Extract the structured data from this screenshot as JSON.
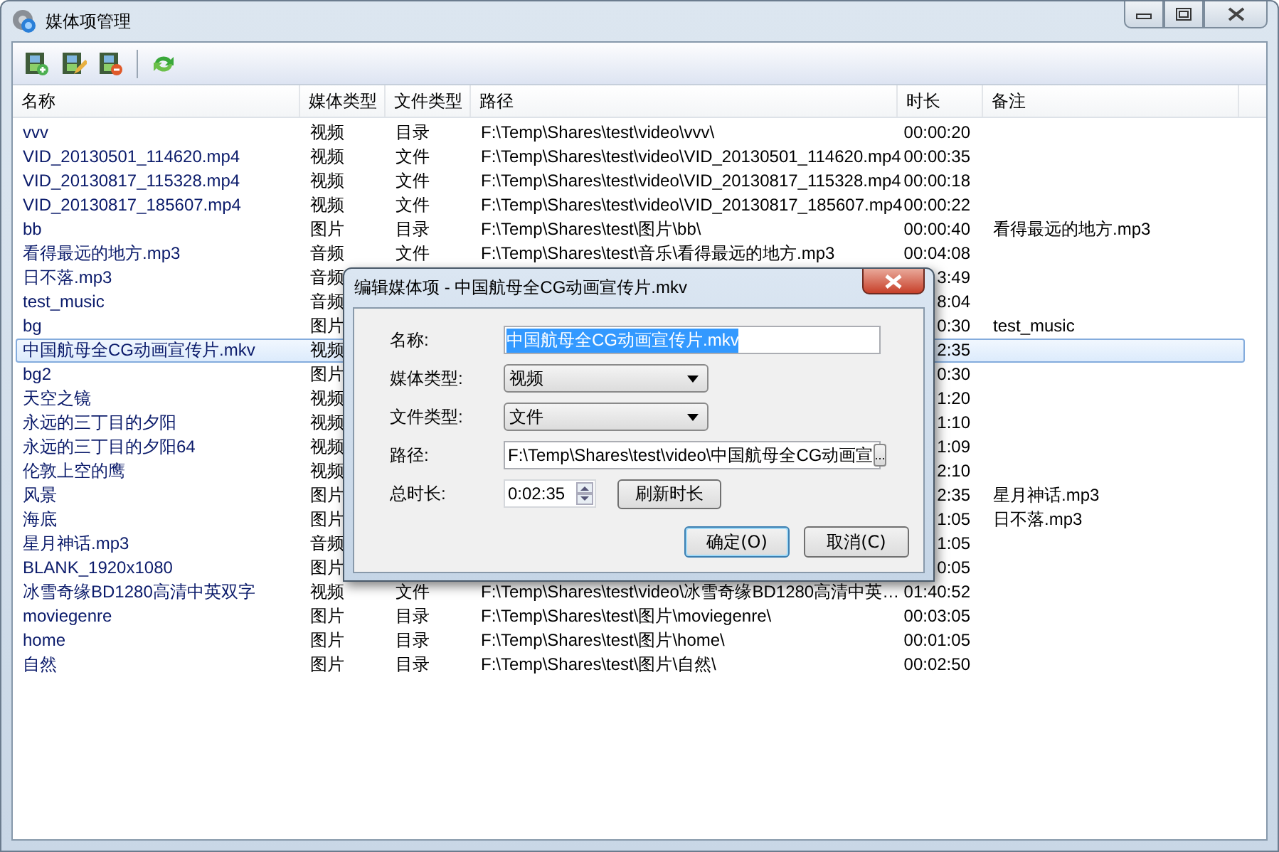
{
  "window": {
    "title": "媒体项管理"
  },
  "toolbar": [
    {
      "kind": "add"
    },
    {
      "kind": "edit"
    },
    {
      "kind": "delete"
    },
    {
      "kind": "refresh"
    }
  ],
  "table": {
    "columns": [
      "名称",
      "媒体类型",
      "文件类型",
      "路径",
      "时长",
      "备注"
    ],
    "rows": [
      {
        "selected": false,
        "name": "vvv",
        "media_type": "视频",
        "file_type": "目录",
        "path": "F:\\Temp\\Shares\\test\\video\\vvv\\",
        "duration": "00:00:20"
      },
      {
        "selected": false,
        "name": "VID_20130501_114620.mp4",
        "media_type": "视频",
        "file_type": "文件",
        "path": "F:\\Temp\\Shares\\test\\video\\VID_20130501_114620.mp4",
        "duration": "00:00:35"
      },
      {
        "selected": false,
        "name": "VID_20130817_115328.mp4",
        "media_type": "视频",
        "file_type": "文件",
        "path": "F:\\Temp\\Shares\\test\\video\\VID_20130817_115328.mp4",
        "duration": "00:00:18"
      },
      {
        "selected": false,
        "name": "VID_20130817_185607.mp4",
        "media_type": "视频",
        "file_type": "文件",
        "path": "F:\\Temp\\Shares\\test\\video\\VID_20130817_185607.mp4",
        "duration": "00:00:22"
      },
      {
        "selected": false,
        "name": "bb",
        "media_type": "图片",
        "file_type": "目录",
        "path": "F:\\Temp\\Shares\\test\\图片\\bb\\",
        "duration": "00:00:40",
        "note": "看得最远的地方.mp3"
      },
      {
        "selected": false,
        "name": "看得最远的地方.mp3",
        "media_type": "音频",
        "file_type": "文件",
        "path": "F:\\Temp\\Shares\\test\\音乐\\看得最远的地方.mp3",
        "duration": "00:04:08"
      },
      {
        "selected": false,
        "name": "日不落.mp3",
        "media_type": "音频",
        "duration": "3:49"
      },
      {
        "selected": false,
        "name": "test_music",
        "media_type": "音频",
        "duration": "8:04"
      },
      {
        "selected": false,
        "name": "bg",
        "media_type": "图片",
        "duration": "0:30",
        "note": "test_music"
      },
      {
        "selected": true,
        "name": "中国航母全CG动画宣传片.mkv",
        "media_type": "视频",
        "duration": "2:35"
      },
      {
        "selected": false,
        "name": "bg2",
        "media_type": "图片",
        "duration": "0:30"
      },
      {
        "selected": false,
        "name": "天空之镜",
        "media_type": "视频",
        "duration": "1:20"
      },
      {
        "selected": false,
        "name": "永远的三丁目的夕阳",
        "media_type": "视频",
        "duration": "1:10"
      },
      {
        "selected": false,
        "name": "永远的三丁目的夕阳64",
        "media_type": "视频",
        "duration": "1:09"
      },
      {
        "selected": false,
        "name": "伦敦上空的鹰",
        "media_type": "视频",
        "duration": "2:10"
      },
      {
        "selected": false,
        "name": "风景",
        "media_type": "图片",
        "duration": "2:35",
        "note": "星月神话.mp3"
      },
      {
        "selected": false,
        "name": "海底",
        "media_type": "图片",
        "duration": "1:05",
        "note": "日不落.mp3"
      },
      {
        "selected": false,
        "name": "星月神话.mp3",
        "media_type": "音频",
        "duration": "1:05"
      },
      {
        "selected": false,
        "name": "BLANK_1920x1080",
        "media_type": "图片",
        "duration": "0:05"
      },
      {
        "selected": false,
        "name": "冰雪奇缘BD1280高清中英双字",
        "media_type": "视频",
        "file_type": "文件",
        "path": "F:\\Temp\\Shares\\test\\video\\冰雪奇缘BD1280高清中英…",
        "duration": "01:40:52"
      },
      {
        "selected": false,
        "name": "moviegenre",
        "media_type": "图片",
        "file_type": "目录",
        "path": "F:\\Temp\\Shares\\test\\图片\\moviegenre\\",
        "duration": "00:03:05"
      },
      {
        "selected": false,
        "name": "home",
        "media_type": "图片",
        "file_type": "目录",
        "path": "F:\\Temp\\Shares\\test\\图片\\home\\",
        "duration": "00:01:05"
      },
      {
        "selected": false,
        "name": "自然",
        "media_type": "图片",
        "file_type": "目录",
        "path": "F:\\Temp\\Shares\\test\\图片\\自然\\",
        "duration": "00:02:50"
      }
    ]
  },
  "dialog": {
    "title": "编辑媒体项 - 中国航母全CG动画宣传片.mkv",
    "name_label": "名称:",
    "name_value": "中国航母全CG动画宣传片.mkv",
    "media_type_label": "媒体类型:",
    "media_type_value": "视频",
    "file_type_label": "文件类型:",
    "file_type_value": "文件",
    "path_label": "路径:",
    "path_value": "F:\\Temp\\Shares\\test\\video\\中国航母全CG动画宣",
    "browse_button": "...",
    "duration_label": "总时长:",
    "duration_value": "0:02:35",
    "refresh_button": "刷新时长",
    "ok_button": "确定(O)",
    "cancel_button": "取消(C)"
  }
}
